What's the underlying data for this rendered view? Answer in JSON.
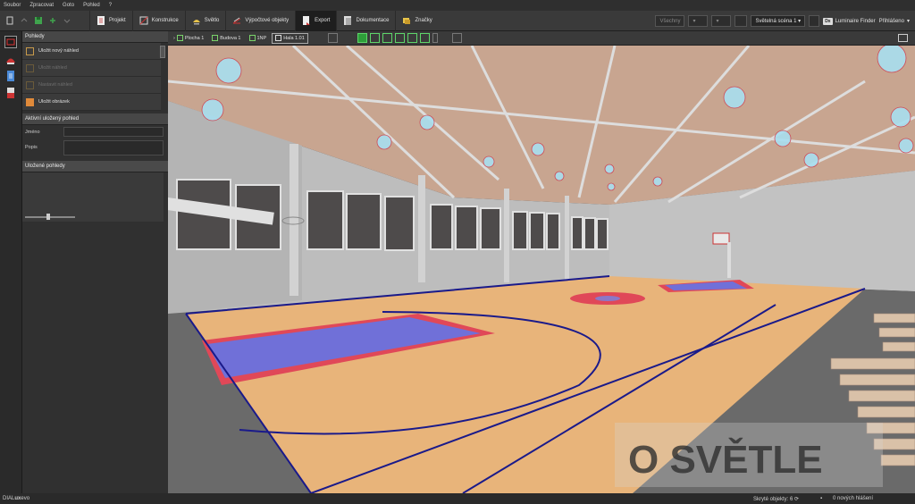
{
  "menu": [
    "Soubor",
    "Zpracovat",
    "Goto",
    "Pohled",
    "?"
  ],
  "toolbar": {
    "modes": [
      "Projekt",
      "Konstrukce",
      "Světlo",
      "Výpočtové objekty",
      "Export",
      "Dokumentace",
      "Značky"
    ],
    "active_mode": "Export",
    "right_disabled_select": "Všechny",
    "light_scene": "Světelná scéna 1",
    "luminaire_finder_badge": "Dx",
    "luminaire_finder_label": "Luminaire Finder",
    "login_label": "Přihlášeno"
  },
  "panel": {
    "title": "Pohledy",
    "actions": [
      "Uložit nový náhled",
      "Uložit náhled",
      "Nastavit náhled",
      "Uložit obrázek"
    ],
    "active_view_title": "Aktivní uložený pohled",
    "name_label": "Jméno",
    "desc_label": "Popis",
    "saved_views_title": "Uložené pohledy"
  },
  "viewport_toolbar": {
    "breadcrumbs": [
      "Plocha 1",
      "Budova 1",
      "1NP",
      "Hala 1.01"
    ]
  },
  "viewport": {
    "watermark": "O SVĚTLE"
  },
  "status": {
    "logo_dial": "DIAL",
    "logo_ux": "ux",
    "logo_evo": "evo",
    "hidden_objects": "Skryté objekty: 6",
    "messages": "0 nových hlášení"
  },
  "colors": {
    "floor": "#e8b47a",
    "court_line": "#1a1a8a",
    "key_blue": "#7070d8",
    "key_red": "#e04858",
    "accent_active": "#1e1e1e"
  }
}
